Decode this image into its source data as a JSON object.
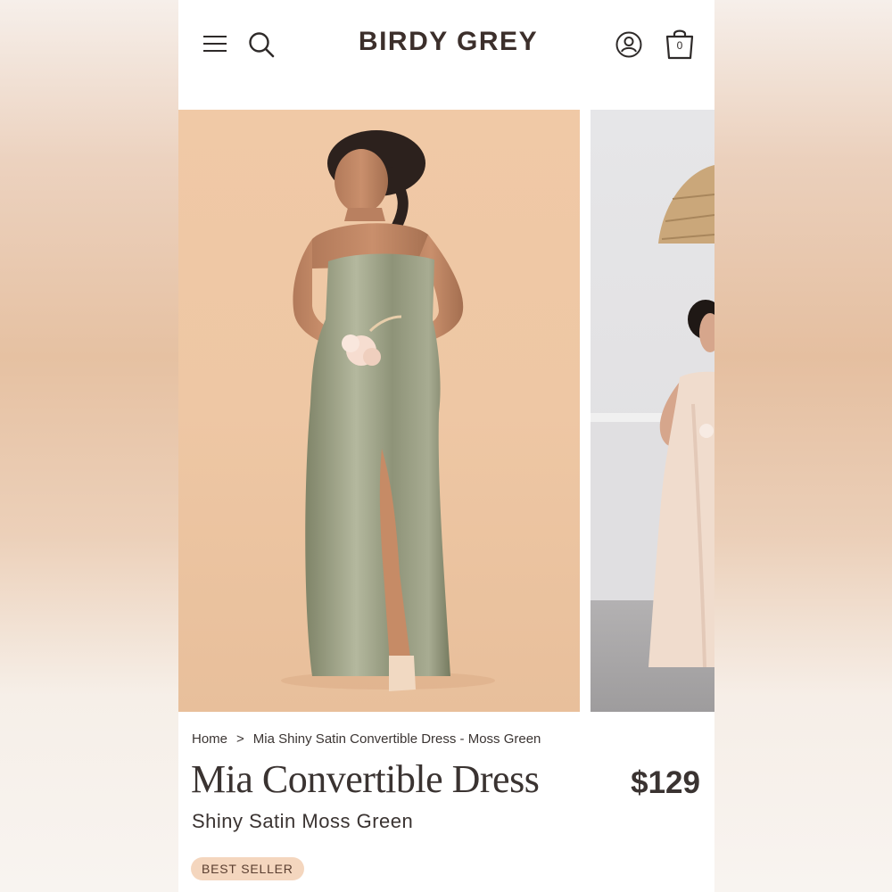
{
  "header": {
    "logo_text": "BIRDY GREY",
    "menu_icon": "hamburger-menu-icon",
    "search_icon": "search-icon",
    "account_icon": "account-icon",
    "cart_icon": "shopping-bag-icon",
    "cart_count": "0"
  },
  "gallery": {
    "images": [
      {
        "label": "main-photo-moss-green-dress"
      },
      {
        "label": "second-photo-champagne-dress"
      }
    ]
  },
  "breadcrumb": {
    "home": "Home",
    "separator": ">",
    "current": "Mia Shiny Satin Convertible Dress - Moss Green"
  },
  "product": {
    "title": "Mia Convertible Dress",
    "price": "$129",
    "subtitle": "Shiny Satin Moss Green",
    "badge": "BEST SELLER"
  },
  "colors": {
    "brand_text": "#3c2f2b",
    "badge_bg": "#f4d6be",
    "photo_bg": "#efc8a5",
    "dress": "#9ba086"
  }
}
